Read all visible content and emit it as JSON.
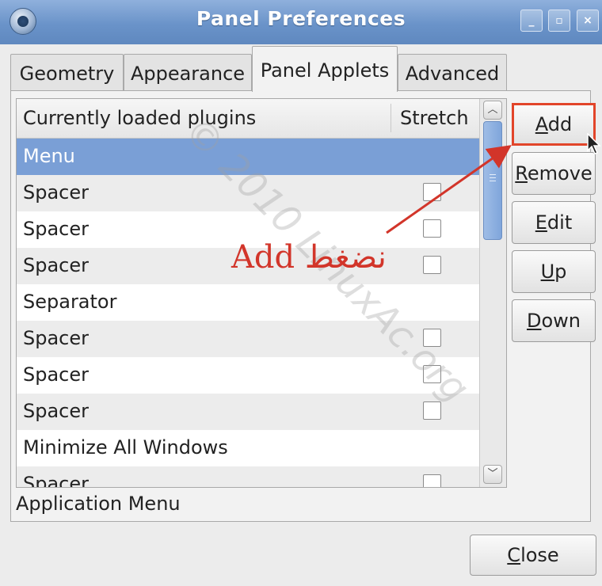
{
  "window": {
    "title": "Panel Preferences",
    "buttons": {
      "minimize": "_",
      "maximize": "▫",
      "close": "×"
    }
  },
  "tabs": [
    {
      "label": "Geometry",
      "active": false
    },
    {
      "label": "Appearance",
      "active": false
    },
    {
      "label": "Panel Applets",
      "active": true
    },
    {
      "label": "Advanced",
      "active": false
    }
  ],
  "plugins": {
    "columns": {
      "name": "Currently loaded plugins",
      "stretch": "Stretch"
    },
    "rows": [
      {
        "name": "Menu",
        "selected": true,
        "stretch": null
      },
      {
        "name": "Spacer",
        "stretch": false
      },
      {
        "name": "Spacer",
        "stretch": false
      },
      {
        "name": "Spacer",
        "stretch": false
      },
      {
        "name": "Separator",
        "stretch": null
      },
      {
        "name": "Spacer",
        "stretch": false
      },
      {
        "name": "Spacer",
        "stretch": false
      },
      {
        "name": "Spacer",
        "stretch": false
      },
      {
        "name": "Minimize All Windows",
        "stretch": null
      },
      {
        "name": "Spacer",
        "stretch": false
      }
    ]
  },
  "status_text": "Application Menu",
  "side_buttons": {
    "add": {
      "pre": "",
      "key": "A",
      "post": "dd"
    },
    "remove": {
      "pre": "",
      "key": "R",
      "post": "emove"
    },
    "edit": {
      "pre": "",
      "key": "E",
      "post": "dit"
    },
    "up": {
      "pre": "",
      "key": "U",
      "post": "p"
    },
    "down": {
      "pre": "",
      "key": "D",
      "post": "own"
    }
  },
  "close_button": {
    "key": "C",
    "post": "lose"
  },
  "annotation": {
    "text": "Add نضغط",
    "color": "#d2352a"
  },
  "watermark": "© 2010 LinuxAc.org",
  "colors": {
    "accent": "#7a9fd6",
    "titlebar": "#6a93c9",
    "annotation": "#d2352a"
  }
}
